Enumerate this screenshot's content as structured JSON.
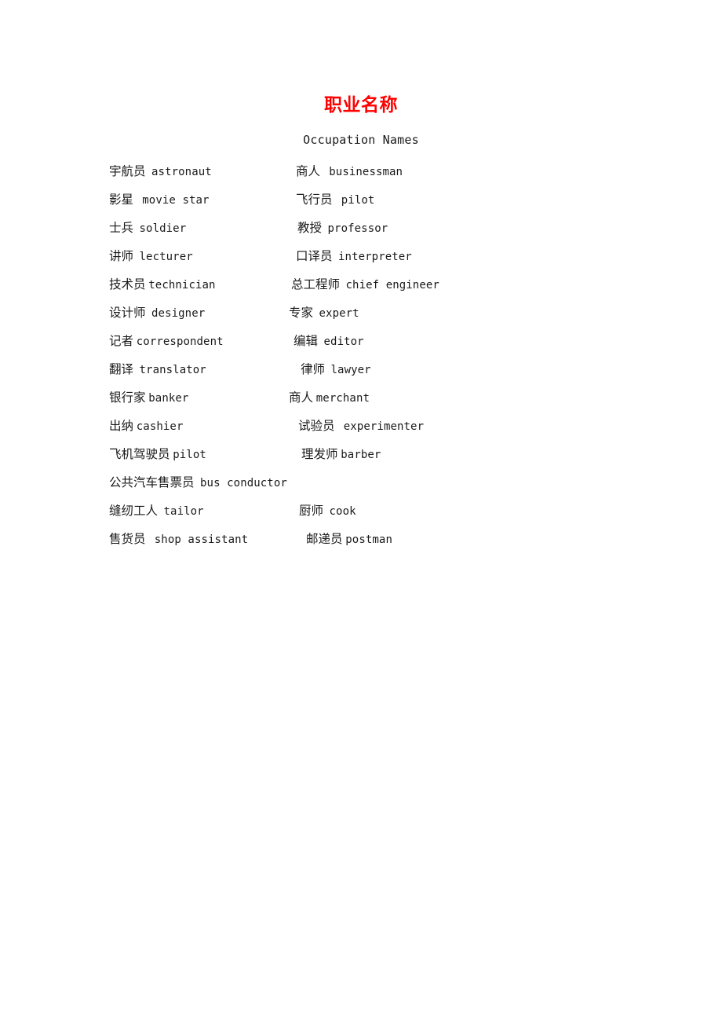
{
  "document": {
    "title": "职业名称",
    "subtitle": "Occupation Names",
    "title_color": "#ff0000",
    "body_color": "#1a1a1a",
    "background_color": "#ffffff"
  },
  "entries": {
    "rows": [
      {
        "left": {
          "zh": "宇航员",
          "en": "astronaut",
          "gap": " "
        },
        "right": {
          "zh": "商人",
          "en": "businessman",
          "gap": "  ",
          "offset": 377
        }
      },
      {
        "left": {
          "zh": "影星",
          "en": "movie star",
          "gap": "  "
        },
        "right": {
          "zh": "飞行员",
          "en": "pilot",
          "gap": "  ",
          "offset": 377
        }
      },
      {
        "left": {
          "zh": "士兵",
          "en": "soldier",
          "gap": " "
        },
        "right": {
          "zh": "教授",
          "en": "professor",
          "gap": " ",
          "offset": 379
        }
      },
      {
        "left": {
          "zh": "讲师",
          "en": "lecturer",
          "gap": " "
        },
        "right": {
          "zh": "口译员",
          "en": "interpreter",
          "gap": " ",
          "offset": 377
        }
      },
      {
        "left": {
          "zh": "技术员",
          "en": "technician",
          "gap": ""
        },
        "right": {
          "zh": "总工程师",
          "en": "chief engineer",
          "gap": " ",
          "offset": 371
        }
      },
      {
        "left": {
          "zh": "设计师",
          "en": "designer",
          "gap": " "
        },
        "right": {
          "zh": "专家",
          "en": "expert",
          "gap": " ",
          "offset": 368
        }
      },
      {
        "left": {
          "zh": "记者",
          "en": "correspondent",
          "gap": ""
        },
        "right": {
          "zh": "编辑",
          "en": "editor",
          "gap": " ",
          "offset": 374
        }
      },
      {
        "left": {
          "zh": "翻译",
          "en": "translator",
          "gap": " "
        },
        "right": {
          "zh": "律师",
          "en": "lawyer",
          "gap": " ",
          "offset": 383
        }
      },
      {
        "left": {
          "zh": "银行家",
          "en": "banker",
          "gap": ""
        },
        "right": {
          "zh": "商人",
          "en": "merchant",
          "gap": "",
          "offset": 368
        }
      },
      {
        "left": {
          "zh": "出纳",
          "en": "cashier",
          "gap": ""
        },
        "right": {
          "zh": "试验员",
          "en": "experimenter",
          "gap": "  ",
          "offset": 380
        }
      },
      {
        "left": {
          "zh": "飞机驾驶员",
          "en": "pilot",
          "gap": ""
        },
        "right": {
          "zh": "理发师",
          "en": "barber",
          "gap": "",
          "offset": 384
        }
      },
      {
        "left": {
          "zh": "公共汽车售票员",
          "en": "bus conductor",
          "gap": " "
        },
        "right": null
      },
      {
        "left": {
          "zh": "缝纫工人",
          "en": "tailor",
          "gap": " "
        },
        "right": {
          "zh": "厨师",
          "en": "cook",
          "gap": " ",
          "offset": 381
        }
      },
      {
        "left": {
          "zh": "售货员",
          "en": "shop assistant",
          "gap": "  "
        },
        "right": {
          "zh": "邮递员",
          "en": "postman",
          "gap": "",
          "offset": 390
        }
      }
    ]
  }
}
